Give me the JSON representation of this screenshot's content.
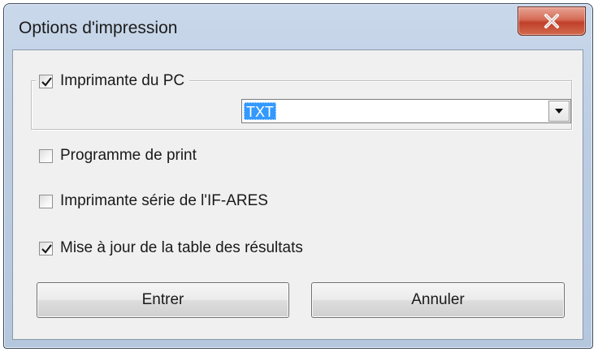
{
  "window": {
    "title": "Options d'impression"
  },
  "options": {
    "pc_printer": {
      "label": "Imprimante du PC",
      "checked": true
    },
    "printer_select": {
      "value": "TXT"
    },
    "print_program": {
      "label": "Programme de print",
      "checked": false
    },
    "serial_printer": {
      "label": "Imprimante série de l'IF-ARES",
      "checked": false
    },
    "update_results": {
      "label": "Mise à jour de la table des résultats",
      "checked": true
    }
  },
  "buttons": {
    "enter": "Entrer",
    "cancel": "Annuler"
  },
  "icons": {
    "close": "close-icon",
    "checkmark": "checkmark-icon",
    "dropdown": "chevron-down-icon"
  },
  "colors": {
    "close_button": "#c0402a",
    "selection": "#3399ff",
    "dialog_background": "#f0f0f0"
  }
}
